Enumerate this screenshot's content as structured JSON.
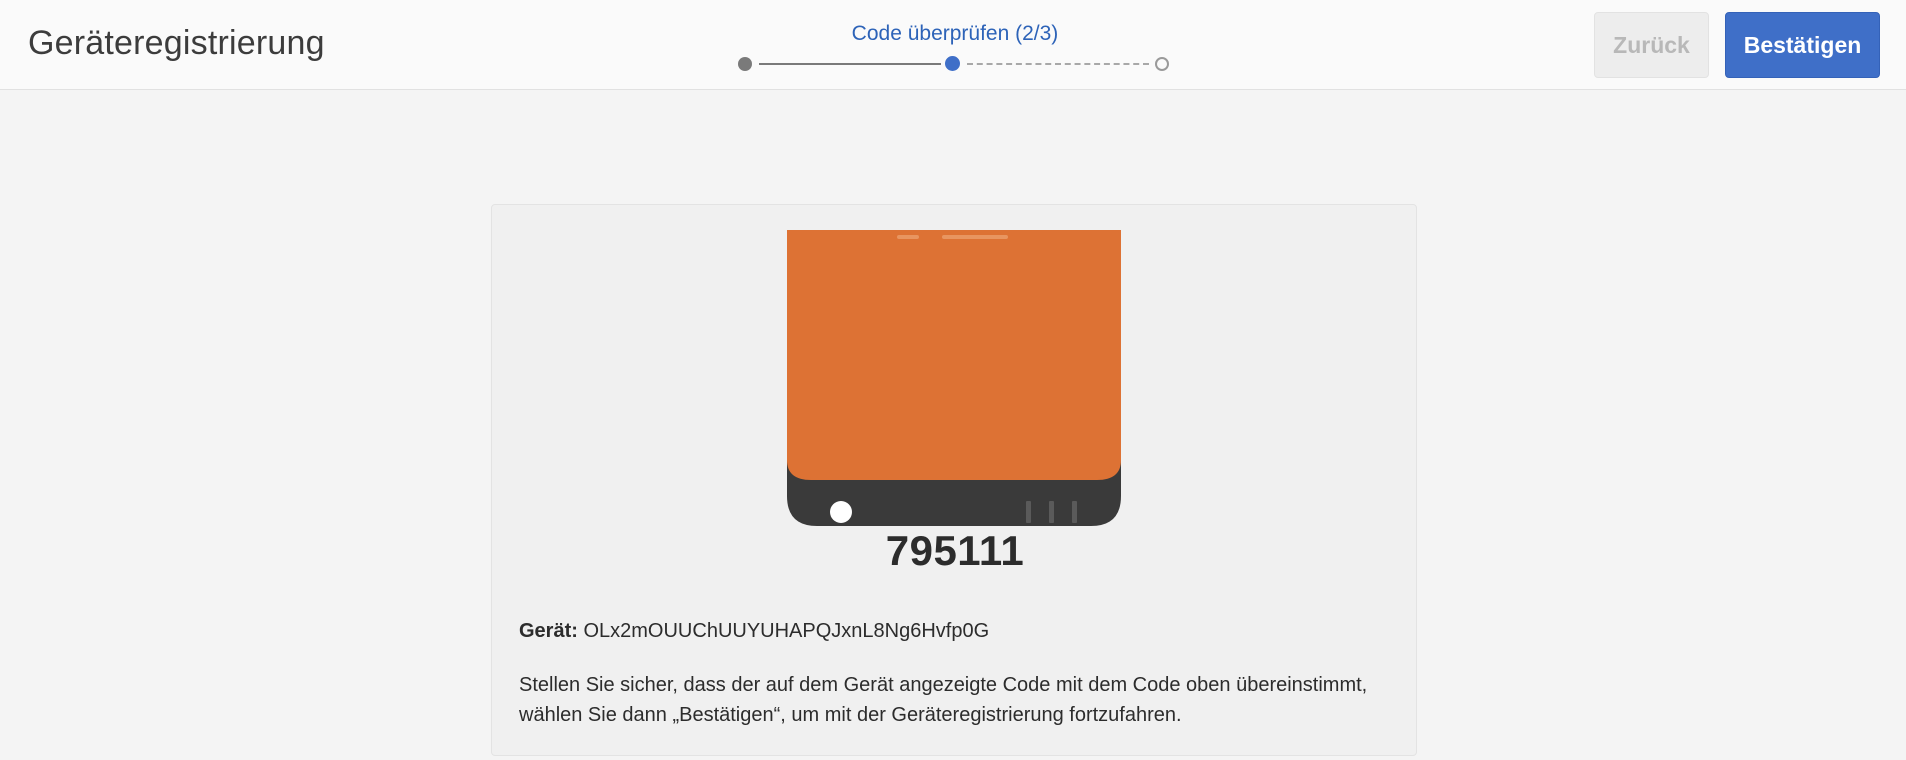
{
  "header": {
    "title": "Geräteregistrierung",
    "step_label": "Code überprüfen (2/3)",
    "back_label": "Zurück",
    "confirm_label": "Bestätigen"
  },
  "stepper": {
    "current_step": 2,
    "total_steps": 3
  },
  "card": {
    "code": "795111",
    "device_label": "Gerät:",
    "device_id": "OLx2mOUUChUUYUHAPQJxnL8Ng6Hvfp0G",
    "description": "Stellen Sie sicher, dass der auf dem Gerät angezeigte Code mit dem Code oben übereinstimmt, wählen Sie dann „Bestätigen“, um mit der Geräteregistrierung fortzufahren."
  },
  "colors": {
    "accent": "#3f6fc8",
    "screen": "#dd7234",
    "device_body": "#3a3a3a"
  },
  "icons": {
    "device": "device-icon"
  }
}
